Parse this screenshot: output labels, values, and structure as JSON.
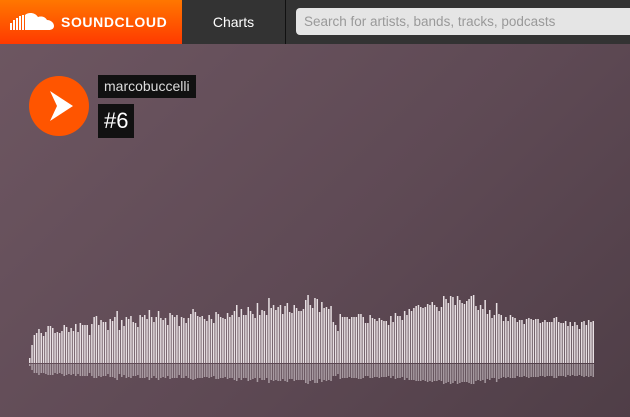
{
  "header": {
    "brand": "SOUNDCLOUD",
    "brand_color": "#ff5500",
    "nav_charts": "Charts",
    "search_placeholder": "Search for artists, bands, tracks, podcasts"
  },
  "track": {
    "artist": "marcobuccelli",
    "title": "#6",
    "waveform": {
      "color": "#e8e0e3",
      "played_fraction": 0,
      "amplitudes": [
        5,
        18,
        28,
        30,
        34,
        30,
        27,
        31,
        37,
        37,
        35,
        30,
        31,
        30,
        32,
        38,
        36,
        31,
        35,
        32,
        39,
        31,
        40,
        38,
        38,
        38,
        28,
        39,
        46,
        47,
        38,
        43,
        41,
        41,
        33,
        44,
        42,
        46,
        52,
        33,
        43,
        37,
        46,
        44,
        47,
        41,
        40,
        36,
        48,
        46,
        48,
        44,
        53,
        46,
        41,
        46,
        52,
        45,
        43,
        45,
        38,
        50,
        48,
        46,
        48,
        37,
        46,
        45,
        40,
        45,
        49,
        54,
        51,
        47,
        46,
        47,
        44,
        42,
        48,
        44,
        40,
        51,
        49,
        46,
        45,
        44,
        50,
        46,
        48,
        52,
        58,
        46,
        54,
        48,
        48,
        56,
        52,
        49,
        45,
        60,
        48,
        53,
        52,
        48,
        65,
        55,
        58,
        53,
        56,
        58,
        49,
        57,
        60,
        51,
        50,
        58,
        55,
        52,
        52,
        54,
        63,
        68,
        58,
        55,
        65,
        64,
        51,
        61,
        55,
        56,
        54,
        57,
        41,
        38,
        32,
        49,
        46,
        46,
        46,
        44,
        46,
        46,
        46,
        49,
        49,
        46,
        40,
        40,
        48,
        45,
        44,
        42,
        45,
        43,
        42,
        42,
        38,
        47,
        41,
        50,
        47,
        47,
        43,
        52,
        48,
        54,
        52,
        55,
        57,
        58,
        56,
        55,
        56,
        59,
        58,
        61,
        58,
        56,
        52,
        56,
        67,
        64,
        60,
        67,
        66,
        58,
        67,
        63,
        60,
        59,
        62,
        64,
        67,
        68,
        57,
        53,
        58,
        54,
        63,
        49,
        53,
        45,
        48,
        60,
        49,
        48,
        42,
        46,
        42,
        48,
        46,
        45,
        41,
        43,
        43,
        39,
        44,
        45,
        44,
        43,
        44,
        44,
        40,
        41,
        43,
        41,
        41,
        41,
        45,
        46,
        41,
        40,
        40,
        42,
        37,
        41,
        37,
        41,
        38,
        34,
        41,
        42,
        38,
        43,
        41,
        42
      ]
    }
  }
}
